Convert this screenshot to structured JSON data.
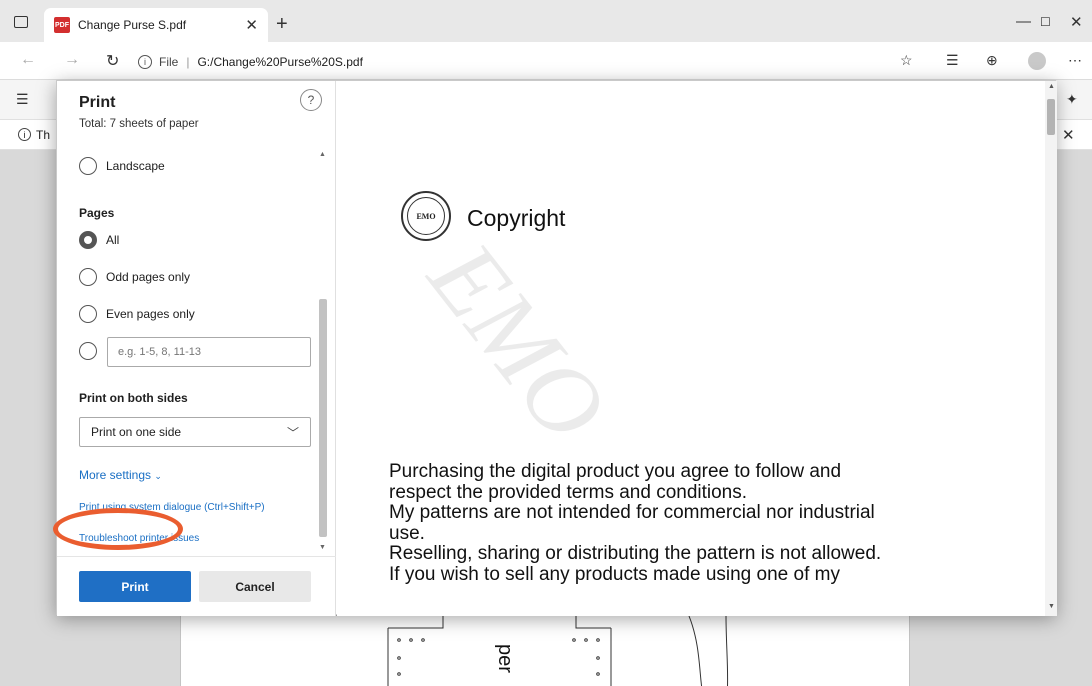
{
  "browser": {
    "tab_title": "Change Purse S.pdf",
    "pdf_badge": "PDF",
    "url_scheme": "File",
    "url_path": "G:/Change%20Purse%20S.pdf",
    "info_bar_text": "Th"
  },
  "print_dialog": {
    "title": "Print",
    "total": "Total: 7 sheets of paper",
    "help_label": "?",
    "layout_option": "Landscape",
    "pages_heading": "Pages",
    "pages_options": [
      "All",
      "Odd pages only",
      "Even pages only"
    ],
    "pages_selected": "All",
    "range_placeholder": "e.g. 1-5, 8, 11-13",
    "duplex_heading": "Print on both sides",
    "duplex_value": "Print on one side",
    "more_settings": "More settings",
    "system_dialog_link": "Print using system dialogue (Ctrl+Shift+P)",
    "troubleshoot_link": "Troubleshoot printer issues",
    "print_button": "Print",
    "cancel_button": "Cancel"
  },
  "preview": {
    "heading": "Copyright",
    "logo_text": "EMO",
    "watermark": "EMO",
    "lines": [
      "Purchasing the digital product you agree to follow and",
      "respect the provided terms and conditions.",
      "My patterns are not intended for commercial nor industrial",
      "use.",
      "Reselling, sharing or distributing the pattern is not allowed.",
      "If you wish to sell any products made using one of my"
    ]
  },
  "background_page": {
    "fragment_text": "per"
  },
  "colors": {
    "accent": "#1f6fc5",
    "highlight": "#ea5d2f",
    "link": "#1a6fc4"
  }
}
